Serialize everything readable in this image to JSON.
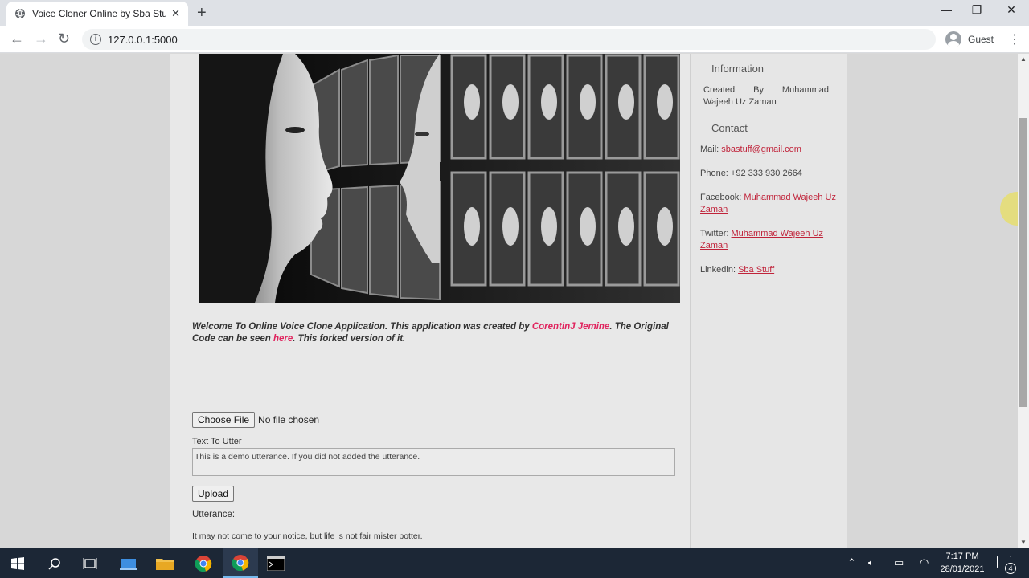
{
  "browser": {
    "tab_title": "Voice Cloner Online by Sba Stuff",
    "url": "127.0.0.1:5000",
    "profile": "Guest"
  },
  "page": {
    "welcome": {
      "part1": "Welcome To Online Voice Clone Application. This application was created by ",
      "author_link": "CorentinJ Jemine",
      "part2": ". The Original Code can be seen ",
      "here_link": "here",
      "part3": ". This forked version of it."
    },
    "file": {
      "button": "Choose File",
      "status": "No file chosen"
    },
    "text_label": "Text To Utter",
    "text_value": "This is a demo utterance. If you did not added the utterance.",
    "upload_button": "Upload",
    "utterance_label": "Utterance:",
    "utterance_text": "It may not come to your notice, but life is not fair mister potter."
  },
  "sidebar": {
    "info_heading": "Information",
    "created_by": {
      "w1": "Created",
      "w2": "By",
      "w3": "Muhammad",
      "line2": "Wajeeh Uz Zaman"
    },
    "contact_heading": "Contact",
    "mail_label": "Mail: ",
    "mail_value": "sbastuff@gmail.com",
    "phone_label": "Phone: ",
    "phone_value": "+92 333 930 2664",
    "facebook_label": "Facebook: ",
    "facebook_value": "Muhammad Wajeeh Uz Zaman",
    "twitter_label": "Twitter: ",
    "twitter_value": "Muhammad Wajeeh Uz Zaman",
    "linkedin_label": "Linkedin: ",
    "linkedin_value": "Sba Stuff"
  },
  "taskbar": {
    "time": "7:17 PM",
    "date": "28/01/2021",
    "notification_count": "4"
  },
  "colors": {
    "link": "#e0245e",
    "taskbar": "#1c2736"
  }
}
